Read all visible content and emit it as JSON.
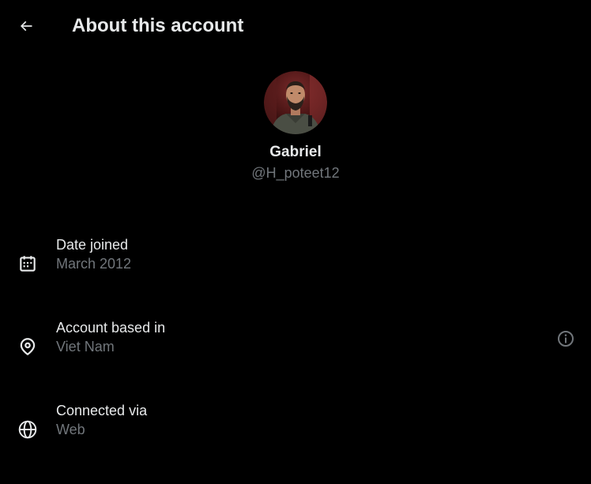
{
  "header": {
    "back_icon": "arrow-left-icon",
    "title": "About this account"
  },
  "profile": {
    "name": "Gabriel",
    "handle": "@H_poteet12"
  },
  "rows": [
    {
      "icon": "calendar-icon",
      "label": "Date joined",
      "value": "March 2012"
    },
    {
      "icon": "location-pin-icon",
      "label": "Account based in",
      "value": "Viet Nam",
      "action_icon": "info-circle-icon"
    },
    {
      "icon": "globe-icon",
      "label": "Connected via",
      "value": "Web"
    }
  ],
  "colors": {
    "background": "#000000",
    "primary_text": "#e7e9ea",
    "secondary_text": "#71767b"
  }
}
